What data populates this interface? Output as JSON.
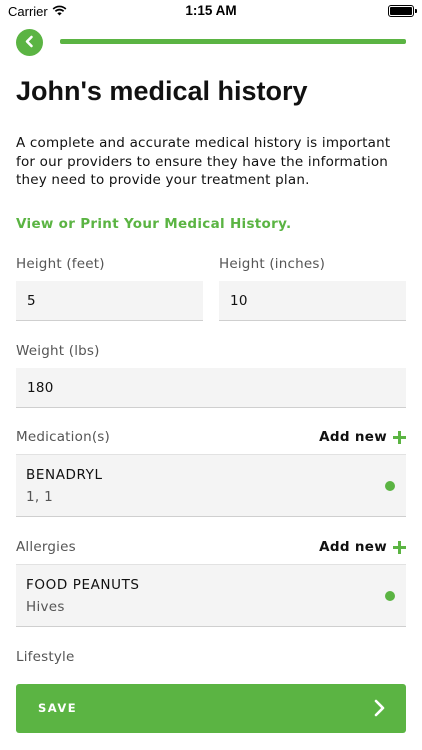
{
  "status_bar": {
    "carrier": "Carrier",
    "time": "1:15 AM"
  },
  "progress": {
    "fraction": 1.0
  },
  "page_title": "John's medical history",
  "intro_text": "A complete and accurate medical history is important for our providers to ensure they have the information they need to provide your treatment plan.",
  "history_link": "View or Print Your Medical History.",
  "fields": {
    "height_feet": {
      "label": "Height (feet)",
      "value": "5"
    },
    "height_inches": {
      "label": "Height (inches)",
      "value": "10"
    },
    "weight": {
      "label": "Weight (lbs)",
      "value": "180"
    }
  },
  "medications": {
    "label": "Medication(s)",
    "add_label": "Add new",
    "items": [
      {
        "title": "BENADRYL",
        "subtitle": "1, 1"
      }
    ]
  },
  "allergies": {
    "label": "Allergies",
    "add_label": "Add new",
    "items": [
      {
        "title": "FOOD PEANUTS",
        "subtitle": "Hives"
      }
    ]
  },
  "lifestyle": {
    "label": "Lifestyle"
  },
  "save_button": {
    "label": "SAVE"
  },
  "colors": {
    "accent": "#5bb443",
    "field_bg": "#f4f4f4",
    "muted_text": "#555555"
  },
  "icons": {
    "back": "chevron-left-icon",
    "add": "plus-icon",
    "save": "chevron-right-icon",
    "wifi": "wifi-icon",
    "battery": "battery-icon"
  }
}
